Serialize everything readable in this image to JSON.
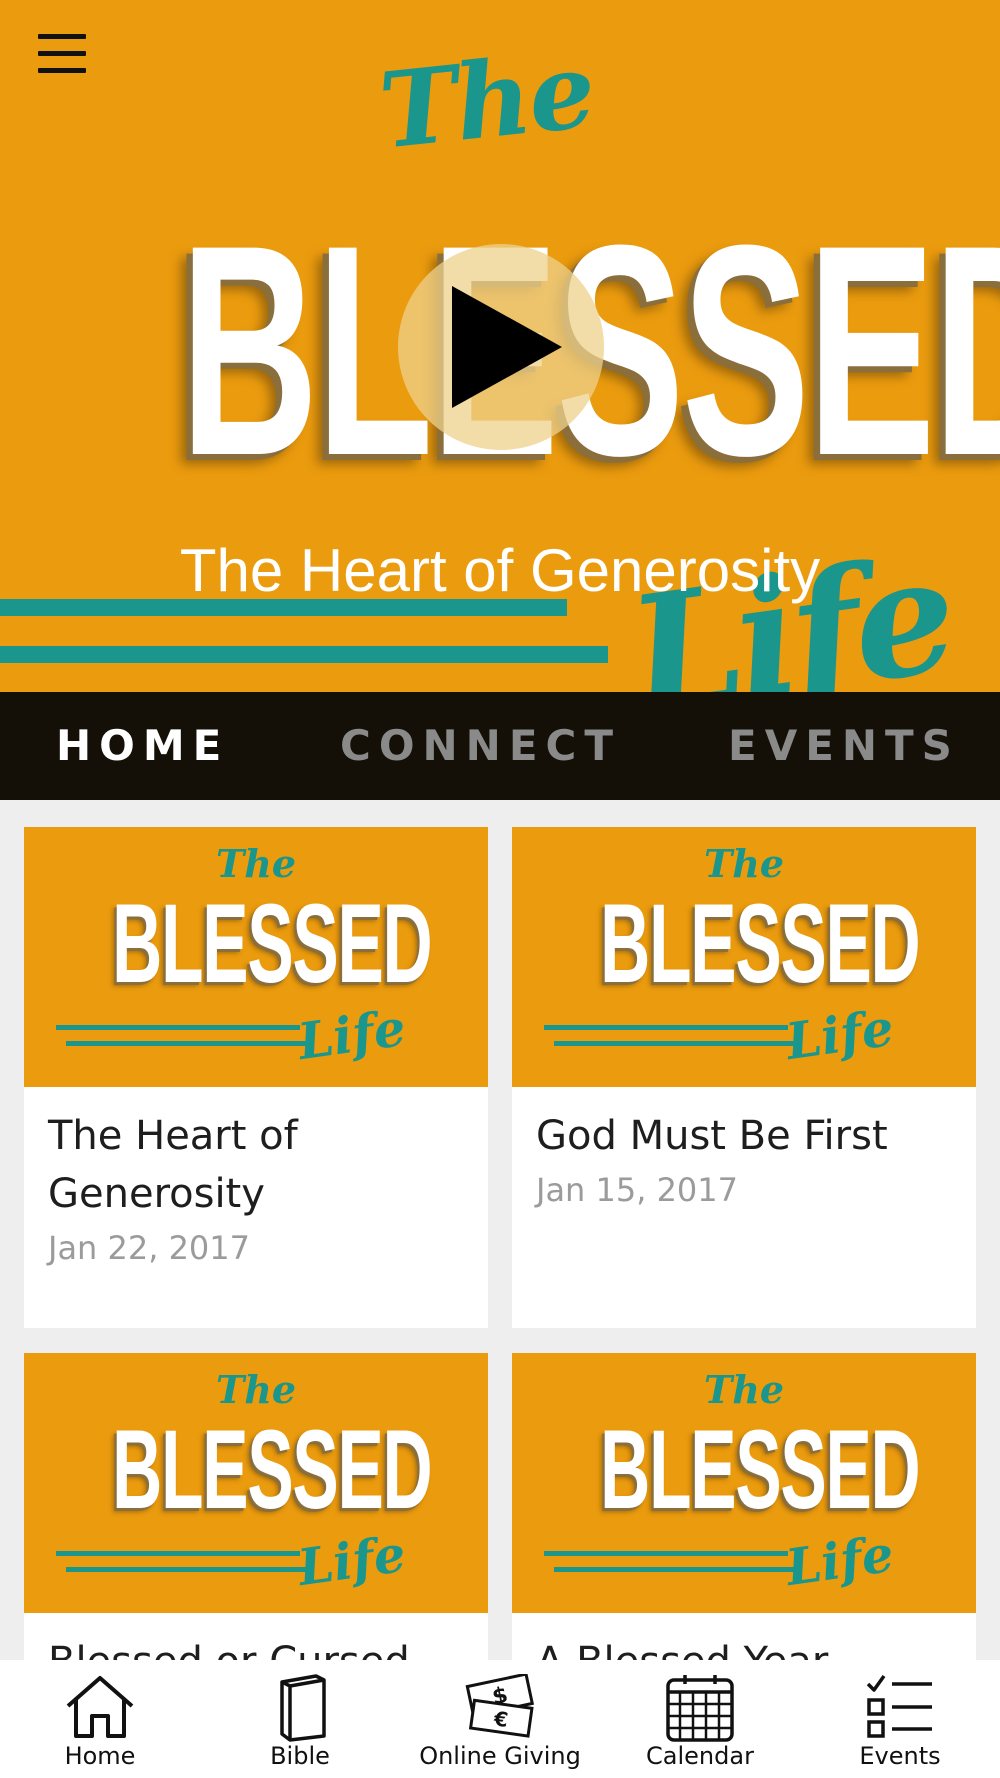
{
  "hero": {
    "logo_the": "The",
    "logo_blessed": "BLESSED",
    "logo_life": "Life",
    "subtitle": "The Heart of Generosity"
  },
  "tabs": [
    {
      "label": "HOME",
      "active": true
    },
    {
      "label": "CONNECT",
      "active": false
    },
    {
      "label": "EVENTS",
      "active": false
    }
  ],
  "cards": [
    {
      "title": "The Heart of Generosity",
      "date": "Jan 22, 2017",
      "thumb": {
        "the": "The",
        "blessed": "BLESSED",
        "life": "Life"
      }
    },
    {
      "title": "God Must Be First",
      "date": "Jan 15, 2017",
      "thumb": {
        "the": "The",
        "blessed": "BLESSED",
        "life": "Life"
      }
    },
    {
      "title": "Blessed or Cursed",
      "date": "",
      "thumb": {
        "the": "The",
        "blessed": "BLESSED",
        "life": "Life"
      }
    },
    {
      "title": "A Blessed Year",
      "date": "",
      "thumb": {
        "the": "The",
        "blessed": "BLESSED",
        "life": "Life"
      }
    }
  ],
  "bottom_nav": [
    {
      "label": "Home",
      "icon": "house-icon"
    },
    {
      "label": "Bible",
      "icon": "book-icon"
    },
    {
      "label": "Online Giving",
      "icon": "money-icon"
    },
    {
      "label": "Calendar",
      "icon": "calendar-icon"
    },
    {
      "label": "Events",
      "icon": "checklist-icon"
    }
  ],
  "colors": {
    "brand_orange": "#eb9b0e",
    "brand_teal": "#1a968c",
    "tabbar_bg": "#140f07",
    "tab_active": "#ffffff",
    "tab_inactive": "#8a8a8a"
  }
}
